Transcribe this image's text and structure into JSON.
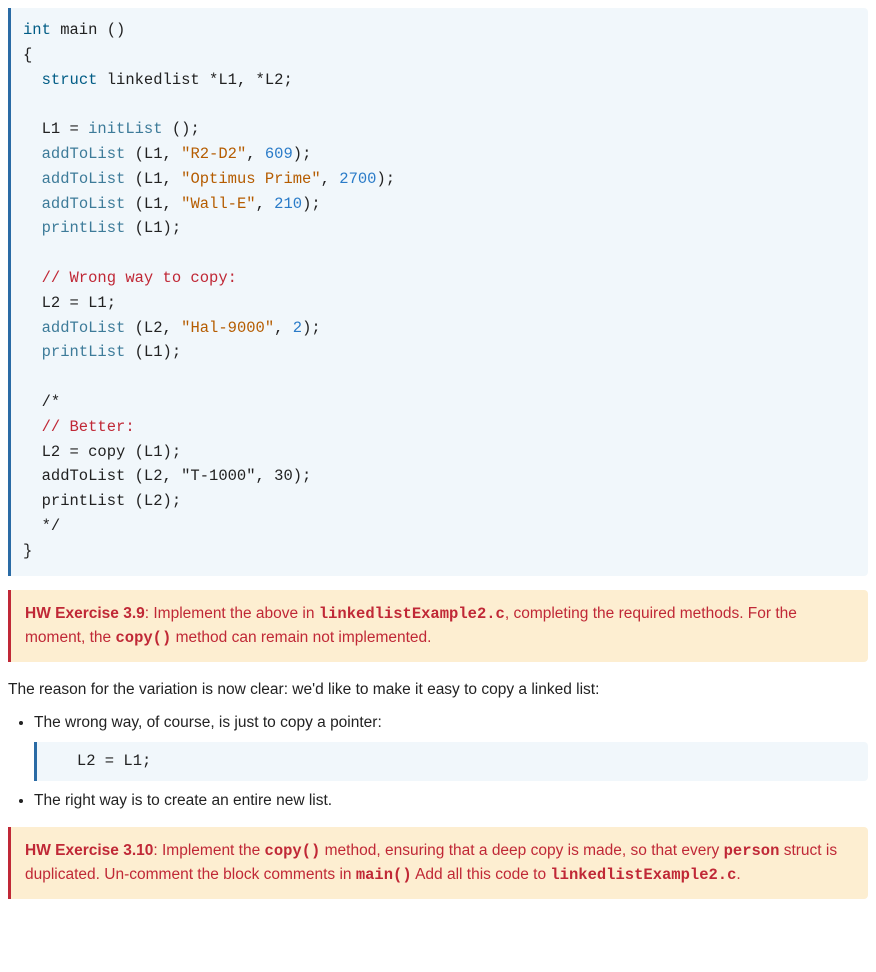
{
  "code_block": {
    "line1_a": "int",
    "line1_b": " main ()",
    "line2": "{",
    "line3_a": "  ",
    "line3_b": "struct",
    "line3_c": " linkedlist *L1, *L2;",
    "line5_a": "  L1 = ",
    "line5_b": "initList",
    "line5_c": " ();",
    "line6_a": "  ",
    "line6_b": "addToList",
    "line6_c": " (L1, ",
    "line6_d": "\"R2-D2\"",
    "line6_e": ", ",
    "line6_f": "609",
    "line6_g": ");",
    "line7_a": "  ",
    "line7_b": "addToList",
    "line7_c": " (L1, ",
    "line7_d": "\"Optimus Prime\"",
    "line7_e": ", ",
    "line7_f": "2700",
    "line7_g": ");",
    "line8_a": "  ",
    "line8_b": "addToList",
    "line8_c": " (L1, ",
    "line8_d": "\"Wall-E\"",
    "line8_e": ", ",
    "line8_f": "210",
    "line8_g": ");",
    "line9_a": "  ",
    "line9_b": "printList",
    "line9_c": " (L1);",
    "line11": "  // Wrong way to copy:",
    "line12": "  L2 = L1;",
    "line13_a": "  ",
    "line13_b": "addToList",
    "line13_c": " (L2, ",
    "line13_d": "\"Hal-9000\"",
    "line13_e": ", ",
    "line13_f": "2",
    "line13_g": ");",
    "line14_a": "  ",
    "line14_b": "printList",
    "line14_c": " (L1);",
    "line16": "  /*",
    "line17": "  // Better:",
    "line18": "  L2 = copy (L1);",
    "line19": "  addToList (L2, \"T-1000\", 30);",
    "line20": "  printList (L2);",
    "line21": "  */",
    "line22": "}"
  },
  "exercise1": {
    "label": "HW Exercise 3.9",
    "text_before_code1": ": Implement the above in ",
    "code1": "linkedlistExample2.c",
    "text_after_code1": ", completing the required methods. For the moment, the ",
    "code2": "copy()",
    "text_after_code2": " method can remain not implemented."
  },
  "body_intro": "The reason for the variation is now clear: we'd like to make it easy to copy a linked list:",
  "bullet1": "The wrong way, of course, is just to copy a pointer:",
  "bullet1_code": "   L2 = L1;",
  "bullet2": "The right way is to create an entire new list.",
  "exercise2": {
    "label": "HW Exercise 3.10",
    "t1": ": Implement the ",
    "c1": "copy()",
    "t2": " method, ensuring that a deep copy is made, so that every ",
    "c2": "person",
    "t3": " struct is duplicated. Un-comment the block comments in ",
    "c3": "main()",
    "t4": " Add all this code to ",
    "c4": "linkedlistExample2.c",
    "t5": "."
  }
}
